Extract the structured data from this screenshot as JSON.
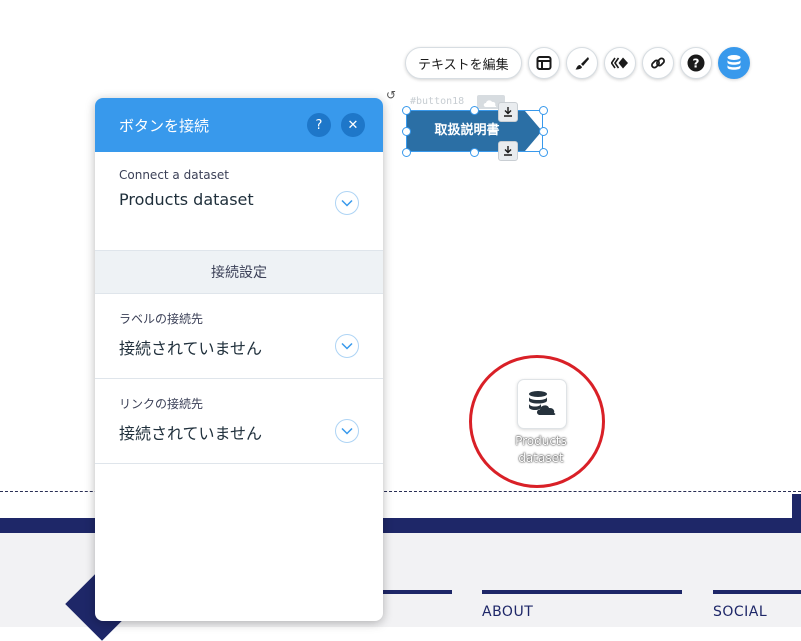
{
  "toolbar": {
    "edit_text_label": "テキストを編集",
    "icons": [
      "layout-icon",
      "design-brush-icon",
      "animation-icon",
      "link-icon",
      "help-icon",
      "database-icon"
    ]
  },
  "element": {
    "id_label": "#button18",
    "button_label": "取扱説明書",
    "color": "#2b6fa5"
  },
  "panel": {
    "title": "ボタンを接続",
    "help_label": "?",
    "close_label": "✕",
    "dataset": {
      "label": "Connect a dataset",
      "value": "Products dataset"
    },
    "group_title": "接続設定",
    "label_connect": {
      "label": "ラベルの接続先",
      "value": "接続されていません"
    },
    "link_connect": {
      "label": "リンクの接続先",
      "value": "接続されていません"
    },
    "accent": "#3899ec"
  },
  "dataset_icon": {
    "line1": "Products",
    "line2": "dataset"
  },
  "footer": {
    "about": "ABOUT",
    "social": "SOCIAL",
    "brand_color": "#1e2768"
  },
  "highlight_color": "#d92027"
}
